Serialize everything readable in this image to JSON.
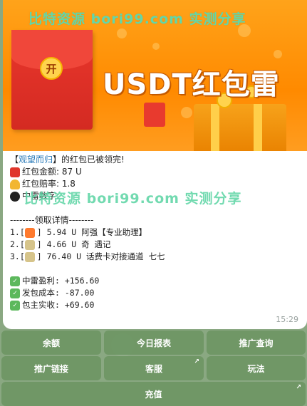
{
  "banner": {
    "watermark": "比特资源 bori99.com 实测分享",
    "envelope_seal": "开",
    "title": "USDT红包雷"
  },
  "message": {
    "line1_prefix": "【",
    "owner": "观望而归",
    "line1_suffix": "】的红包已被领完!",
    "amount_label": "红包金额: 87 U",
    "odds_label": "红包赔率: 1.8",
    "mine_label": "中雷数字: ",
    "watermark": "比特资源 bori99.com 实测分享",
    "details_header": "--------领取详情--------",
    "claims": [
      {
        "index": "1.[",
        "icon": "boom-icon",
        "text": "] 5.94 U 阿强【专业助理】"
      },
      {
        "index": "2.[",
        "icon": "money-icon",
        "text": "] 4.66 U 奇 遇记"
      },
      {
        "index": "3.[",
        "icon": "money-icon",
        "text": "] 76.40 U 话费卡对接通道 七七"
      }
    ],
    "summary": [
      {
        "label": "中雷盈利: +156.60"
      },
      {
        "label": "发包成本: -87.00"
      },
      {
        "label": "包主实收: +69.60"
      }
    ],
    "time": "15:29"
  },
  "keyboard": {
    "row1": [
      "余额",
      "今日报表",
      "推广查询"
    ],
    "row2": [
      "推广链接",
      "客服",
      "玩法"
    ],
    "row3": [
      "充值"
    ]
  }
}
